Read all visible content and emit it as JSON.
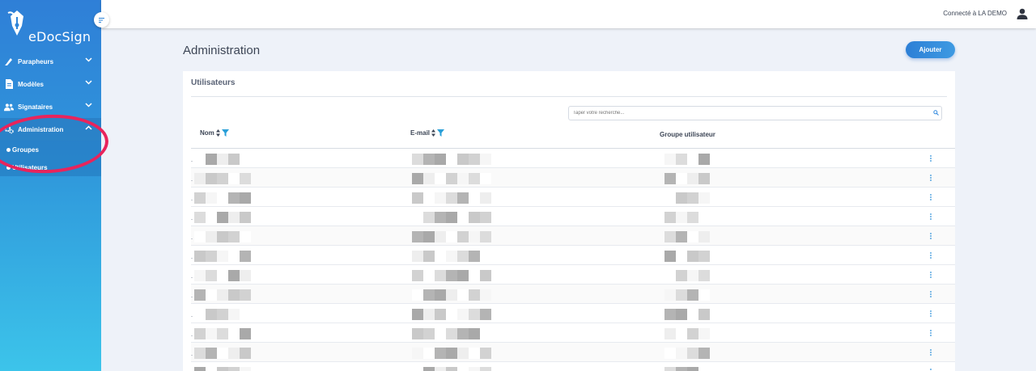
{
  "app": {
    "name": "eDocSign"
  },
  "header": {
    "connected_text": "Connecté à LA DEMO"
  },
  "sidebar": {
    "items": [
      {
        "label": "Parapheurs",
        "icon": "signature-pen-icon"
      },
      {
        "label": "Modèles",
        "icon": "document-icon"
      },
      {
        "label": "Signataires",
        "icon": "users-icon"
      },
      {
        "label": "Administration",
        "icon": "gears-icon"
      }
    ],
    "sub_items": [
      {
        "label": "Groupes"
      },
      {
        "label": "Utilisateurs"
      }
    ]
  },
  "main": {
    "title": "Administration",
    "add_button": "Ajouter",
    "card_title": "Utilisateurs",
    "search_placeholder": "Taper votre recherche...",
    "columns": {
      "nom": "Nom",
      "email": "E-mail",
      "groupe": "Groupe utilisateur"
    },
    "row_count": 12
  },
  "colors": {
    "sidebar_top": "#2f7fd7",
    "sidebar_bottom": "#3cc4ea",
    "accent": "#2c8fd9",
    "annotation": "#e8245c"
  }
}
